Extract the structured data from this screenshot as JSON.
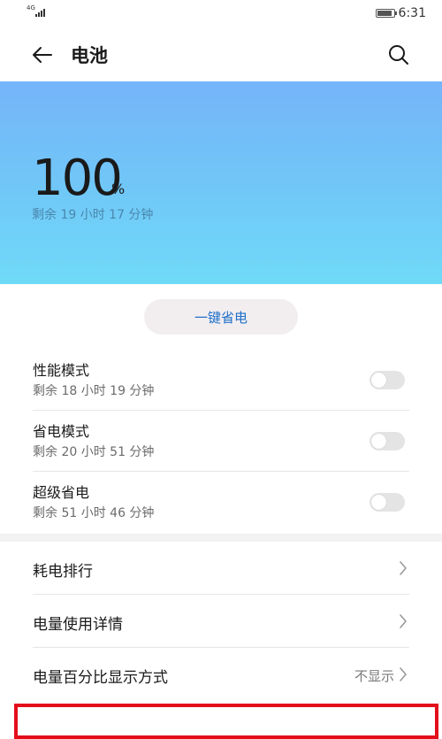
{
  "status_bar": {
    "network": "4G",
    "time": "6:31"
  },
  "app_bar": {
    "title": "电池"
  },
  "battery": {
    "percent_value": "100",
    "percent_sign": "%",
    "remaining": "剩余 19 小时 17 分钟",
    "level": 1.0
  },
  "saver_button": {
    "label": "一键省电"
  },
  "modes": [
    {
      "title": "性能模式",
      "remaining": "剩余 18 小时 19 分钟",
      "enabled": false
    },
    {
      "title": "省电模式",
      "remaining": "剩余 20 小时 51 分钟",
      "enabled": false
    },
    {
      "title": "超级省电",
      "remaining": "剩余 51 小时 46 分钟",
      "enabled": false
    }
  ],
  "list": [
    {
      "label": "耗电排行",
      "value": ""
    },
    {
      "label": "电量使用详情",
      "value": ""
    },
    {
      "label": "电量百分比显示方式",
      "value": "不显示"
    }
  ],
  "colors": {
    "hero_top": "#75b4f9",
    "hero_bottom": "#6fdaf8",
    "accent_blue": "#1f6fc9",
    "highlight_red": "#e30e1a"
  }
}
